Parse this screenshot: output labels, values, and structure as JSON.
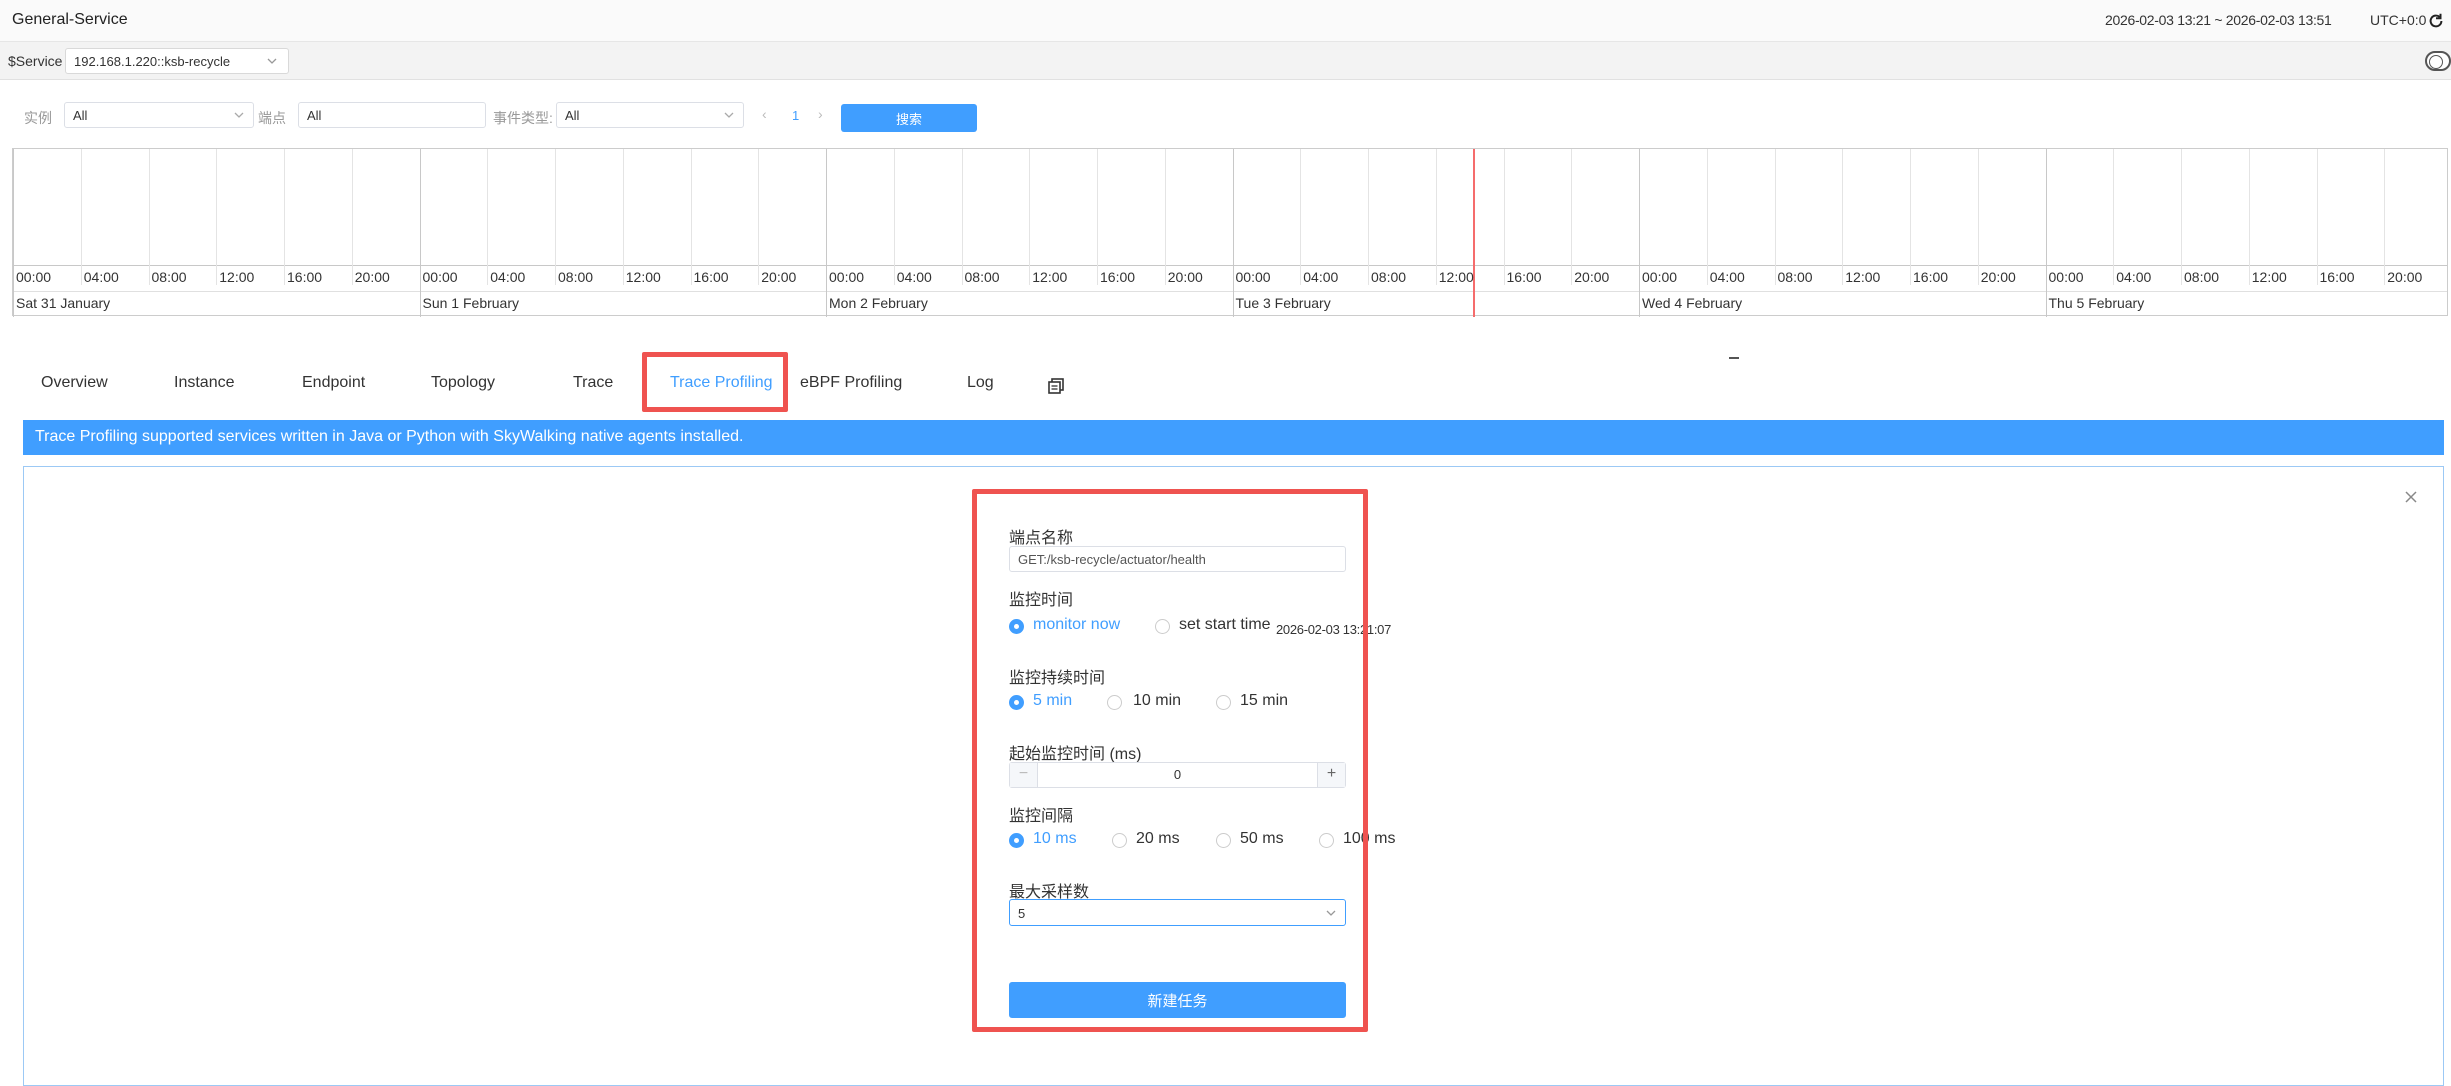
{
  "header": {
    "title": "General-Service",
    "time_range": "2026-02-03 13:21 ~ 2026-02-03 13:51",
    "timezone": "UTC+0:0"
  },
  "variables": {
    "label": "$Service",
    "service_value": "192.168.1.220::ksb-recycle"
  },
  "filters": {
    "instance_label": "实例",
    "instance_value": "All",
    "endpoint_label": "端点",
    "endpoint_value": "All",
    "event_type_label": "事件类型:",
    "event_type_value": "All",
    "page": "1",
    "prev": "‹",
    "next": "›",
    "search_label": "搜索"
  },
  "timeline": {
    "hours": [
      "00:00",
      "04:00",
      "08:00",
      "12:00",
      "16:00",
      "20:00"
    ],
    "days": [
      "Sat 31 January",
      "Sun 1 February",
      "Mon 2 February",
      "Tue 3 February",
      "Wed 4 February",
      "Thu 5 February"
    ]
  },
  "tabs": [
    {
      "label": "Overview"
    },
    {
      "label": "Instance"
    },
    {
      "label": "Endpoint"
    },
    {
      "label": "Topology"
    },
    {
      "label": "Trace"
    },
    {
      "label": "Trace Profiling"
    },
    {
      "label": "eBPF Profiling"
    },
    {
      "label": "Log"
    }
  ],
  "active_tab": "Trace Profiling",
  "banner": "Trace Profiling supported services written in Java or Python with SkyWalking native agents installed.",
  "form": {
    "endpoint_name_label": "端点名称",
    "endpoint_name_value": "GET:/ksb-recycle/actuator/health",
    "monitor_time_label": "监控时间",
    "monitor_now": "monitor now",
    "set_start_time": "set start time",
    "start_time_value": "2026-02-03 13:21:07",
    "duration_label": "监控持续时间",
    "duration_options": [
      "5 min",
      "10 min",
      "15 min"
    ],
    "duration_selected": "5 min",
    "start_threshold_label": "起始监控时间 (ms)",
    "start_threshold_value": "0",
    "interval_label": "监控间隔",
    "interval_options": [
      "10 ms",
      "20 ms",
      "50 ms",
      "100 ms"
    ],
    "interval_selected": "10 ms",
    "max_samples_label": "最大采样数",
    "max_samples_value": "5",
    "create_button": "新建任务"
  },
  "colors": {
    "accent": "#409eff",
    "highlight": "#ef5350",
    "now_marker": "#f56c6c"
  }
}
